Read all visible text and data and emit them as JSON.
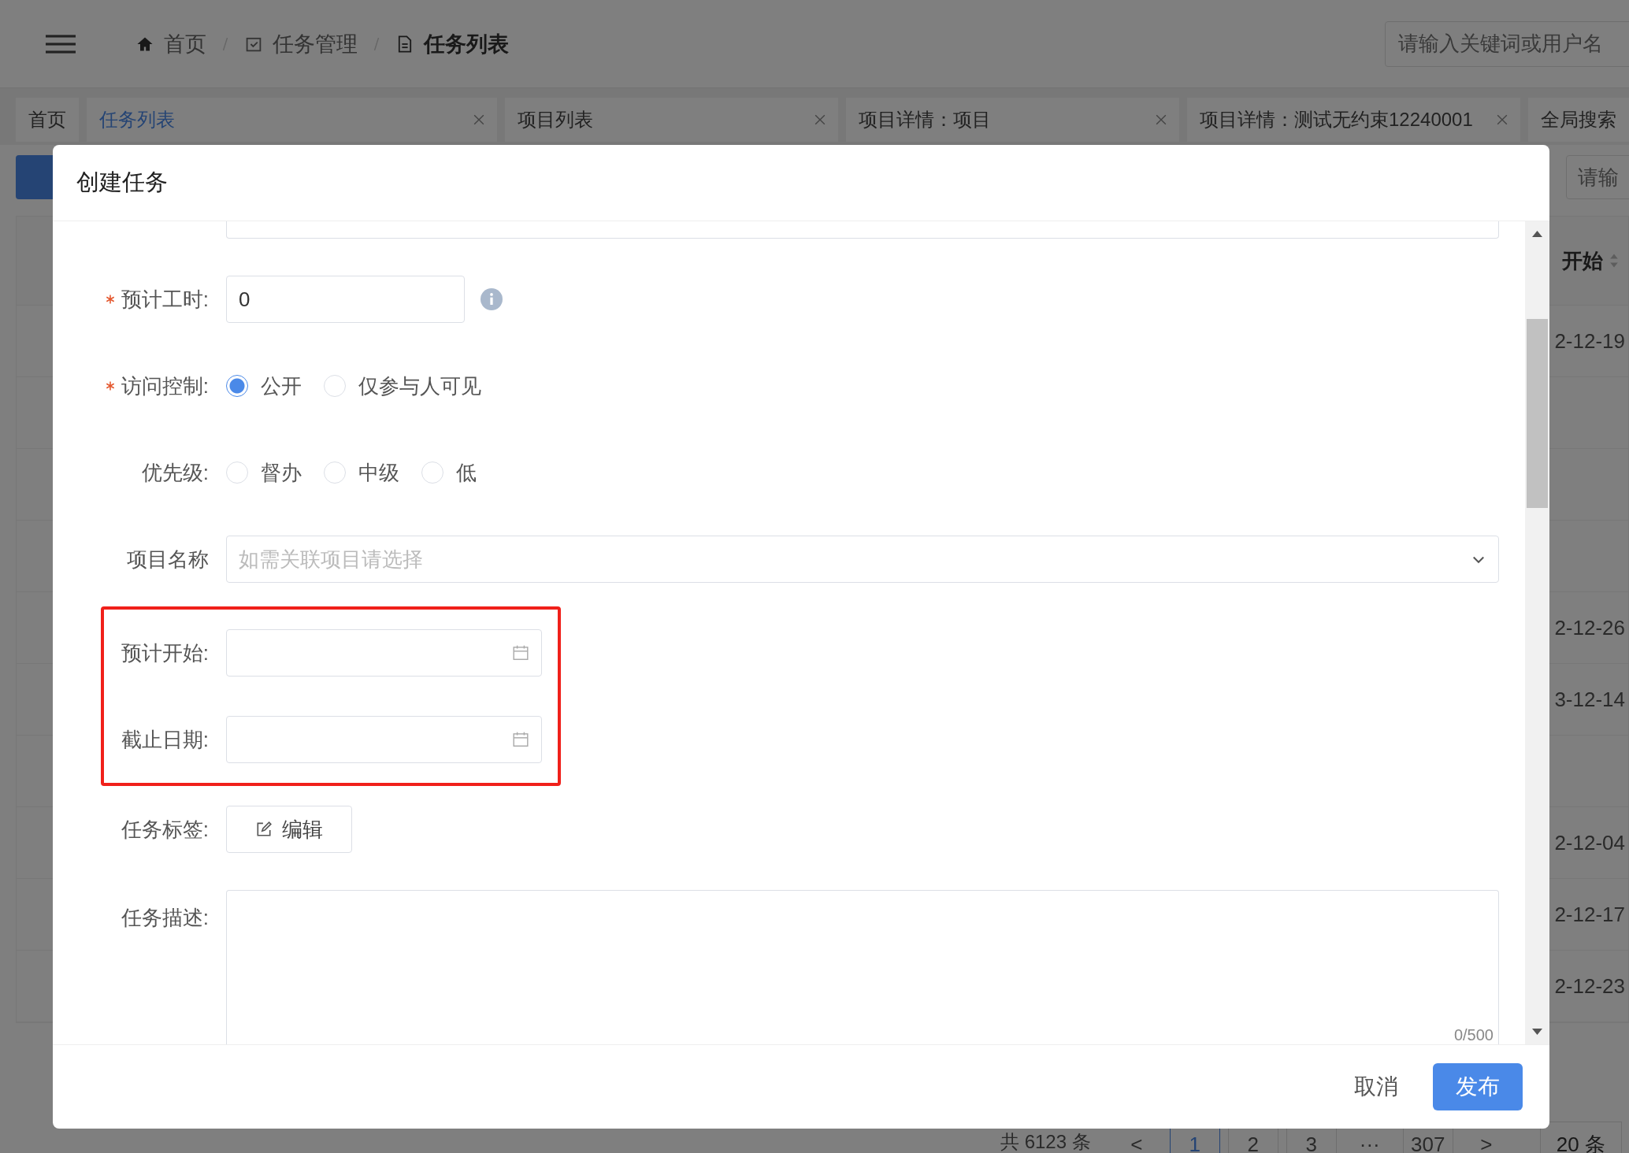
{
  "header": {
    "breadcrumbs": [
      {
        "label": "首页",
        "kind": "home"
      },
      {
        "label": "任务管理",
        "kind": "check"
      },
      {
        "label": "任务列表",
        "kind": "doc"
      }
    ],
    "search": {
      "placeholder": "请输入关键词或用户名"
    }
  },
  "tabs": [
    {
      "label": "首页",
      "selected": false,
      "closable": false
    },
    {
      "label": "任务列表",
      "selected": true,
      "closable": true
    },
    {
      "label": "项目列表",
      "selected": false,
      "closable": true
    },
    {
      "label": "项目详情：项目",
      "selected": false,
      "closable": true
    },
    {
      "label": "项目详情：测试无约束12240001",
      "selected": false,
      "closable": true
    },
    {
      "label": "全局搜索",
      "selected": false,
      "closable": false
    }
  ],
  "toolbar": {
    "search": {
      "placeholder": "请输"
    }
  },
  "table": {
    "column": "开始",
    "rows": [
      {
        "cell": "2-12-19"
      },
      {
        "cell": null
      },
      {
        "cell": null
      },
      {
        "cell": null
      },
      {
        "cell": "2-12-26"
      },
      {
        "cell": "3-12-14"
      },
      {
        "cell": null
      },
      {
        "cell": "2-12-04"
      },
      {
        "cell": "2-12-17"
      },
      {
        "cell": "2-12-23"
      }
    ]
  },
  "pagination": {
    "total": "共 6123 条",
    "pages": [
      {
        "label": "<",
        "kind": "arrow"
      },
      {
        "label": "1",
        "kind": "page",
        "selected": true
      },
      {
        "label": "2",
        "kind": "page",
        "selected": false
      },
      {
        "label": "3",
        "kind": "page",
        "selected": false
      },
      {
        "label": "···",
        "kind": "ellipsis"
      },
      {
        "label": "307",
        "kind": "page",
        "selected": false
      },
      {
        "label": ">",
        "kind": "arrow"
      }
    ],
    "page_size": "20 条"
  },
  "dialog": {
    "title": "创建任务",
    "fields": [
      {
        "kind": "partial"
      },
      {
        "kind": "number",
        "label": "预计工时:",
        "required": true,
        "value": "0"
      },
      {
        "kind": "radio",
        "label": "访问控制:",
        "required": true,
        "options": [
          {
            "label": "公开",
            "selected": true
          },
          {
            "label": "仅参与人可见",
            "selected": false
          }
        ]
      },
      {
        "kind": "radio",
        "label": "优先级:",
        "required": false,
        "options": [
          {
            "label": "督办",
            "selected": false
          },
          {
            "label": "中级",
            "selected": false
          },
          {
            "label": "低",
            "selected": false
          }
        ]
      },
      {
        "kind": "select",
        "label": "项目名称",
        "required": false,
        "placeholder": "如需关联项目请选择"
      },
      {
        "kind": "group",
        "highlighted": true,
        "fields": [
          {
            "kind": "date",
            "label": "预计开始:",
            "required": false
          },
          {
            "kind": "date",
            "label": "截止日期:",
            "required": false
          }
        ]
      },
      {
        "kind": "tags",
        "label": "任务标签:",
        "required": false,
        "button": "编辑"
      },
      {
        "kind": "textarea",
        "label": "任务描述:",
        "required": false,
        "counter": "0/500"
      }
    ],
    "buttons": {
      "cancel": "取消",
      "submit": "发布"
    }
  }
}
